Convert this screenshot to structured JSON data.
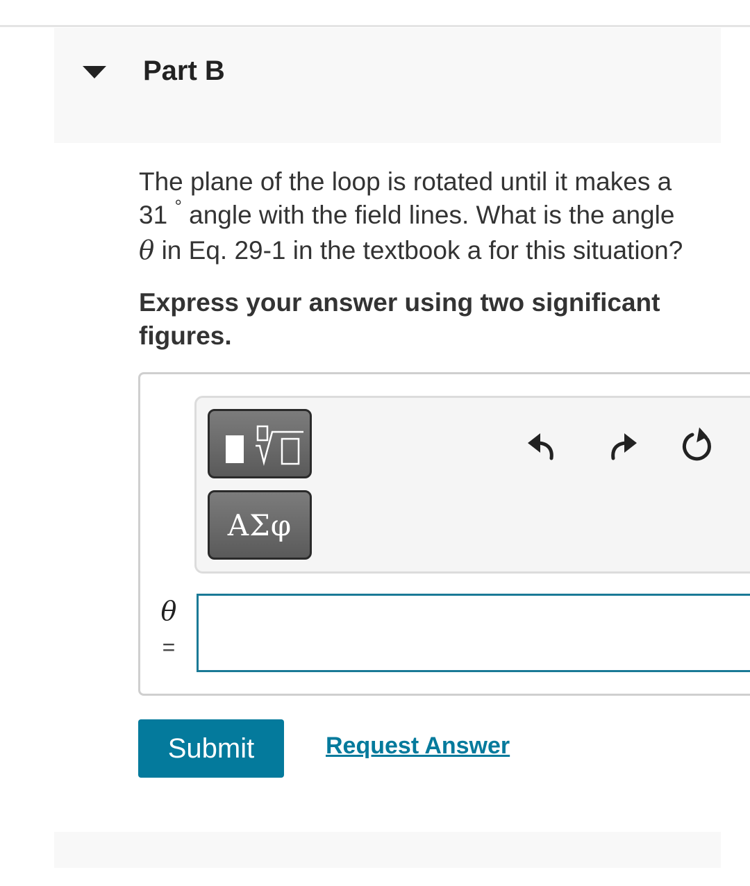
{
  "part": {
    "title": "Part B"
  },
  "question": {
    "line1": "The plane of the loop is rotated until it makes a",
    "angle_value": "31",
    "degree_symbol": "°",
    "line2_rest": "angle with the field lines. What is the angle",
    "theta_symbol": "θ",
    "line3_rest": "in Eq. 29-1 in the textbook a for this situation?"
  },
  "instruction": "Express your answer using two significant figures.",
  "toolbar": {
    "symbols_label": "ΑΣφ"
  },
  "answer": {
    "variable": "θ",
    "equals": "=",
    "value": ""
  },
  "actions": {
    "submit_label": "Submit",
    "request_label": "Request Answer"
  },
  "colors": {
    "accent": "#047a9c",
    "input_border": "#1a7a96"
  }
}
